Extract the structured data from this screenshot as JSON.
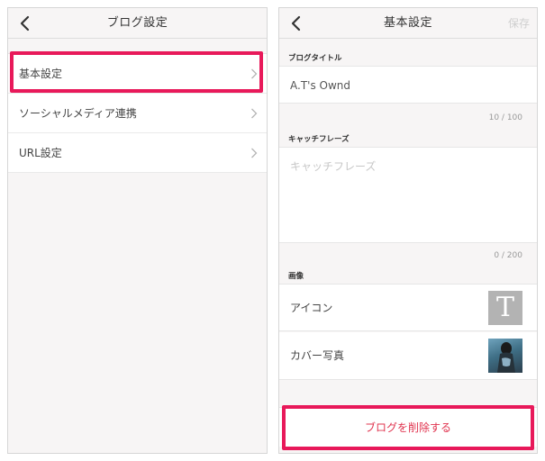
{
  "left_screen": {
    "title": "ブログ設定",
    "menu": [
      {
        "label": "基本設定"
      },
      {
        "label": "ソーシャルメディア連携"
      },
      {
        "label": "URL設定"
      }
    ]
  },
  "right_screen": {
    "title": "基本設定",
    "save_label": "保存",
    "blog_title": {
      "label": "ブログタイトル",
      "value": "A.T's Ownd",
      "counter": "10 / 100"
    },
    "catchphrase": {
      "label": "キャッチフレーズ",
      "placeholder": "キャッチフレーズ",
      "counter": "0 / 200"
    },
    "image": {
      "label": "画像",
      "icon_label": "アイコン",
      "icon_letter": "T",
      "cover_label": "カバー写真"
    },
    "delete_label": "ブログを削除する"
  },
  "colors": {
    "highlight": "#e8195a",
    "delete_text": "#e0334e",
    "background": "#f7f5f5"
  }
}
